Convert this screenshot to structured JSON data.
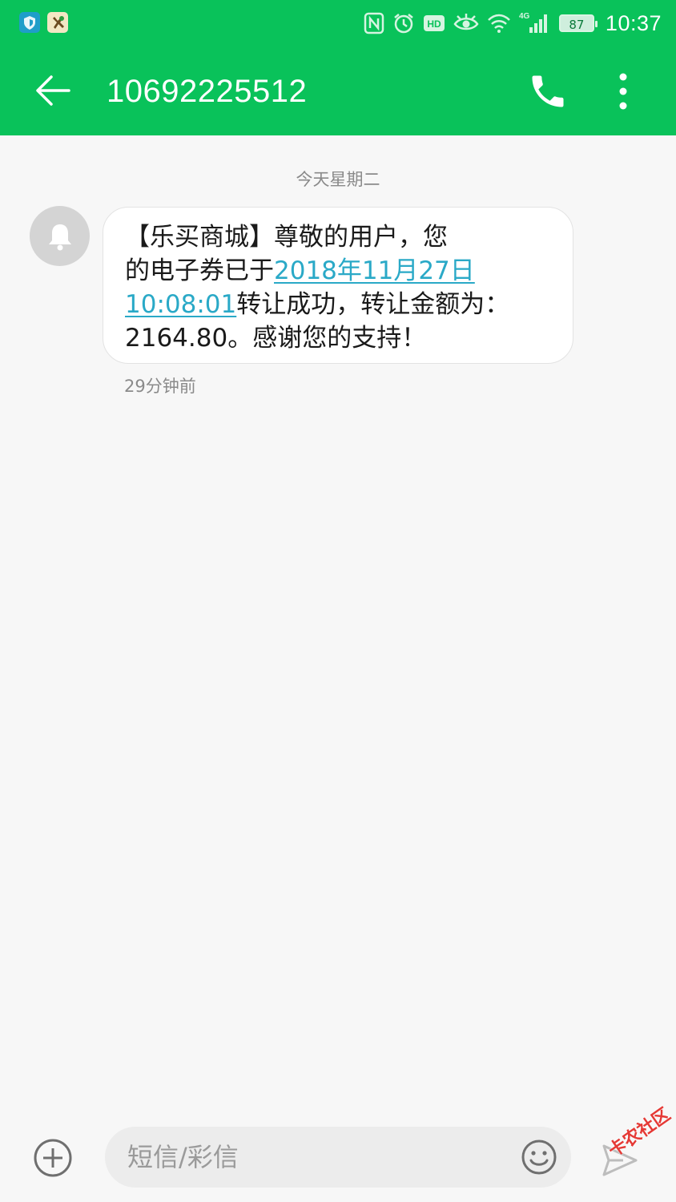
{
  "status_bar": {
    "time": "10:37",
    "battery": "87",
    "network": "4G",
    "icons": [
      "shield-app-icon",
      "tool-app-icon",
      "nfc-icon",
      "alarm-icon",
      "hd-icon",
      "eye-icon",
      "wifi-icon",
      "signal-icon",
      "battery-icon"
    ]
  },
  "toolbar": {
    "title": "10692225512",
    "back_icon": "back-arrow-icon",
    "call_icon": "phone-icon",
    "menu_icon": "more-vert-icon"
  },
  "conversation": {
    "date_header": "今天星期二",
    "message": {
      "line1": "【乐买商城】尊敬的用户，您",
      "line2_prefix": "的电子券已于",
      "line2_link": "2018年11月27日",
      "line3_link": "10:08:01",
      "line3_suffix": "转让成功，转让金额为：",
      "line4": "2164.80。感谢您的支持！"
    },
    "time": "29分钟前"
  },
  "input_bar": {
    "placeholder": "短信/彩信",
    "add_icon": "add-circle-icon",
    "emoji_icon": "emoji-icon",
    "send_icon": "send-icon"
  },
  "watermark": "卡农社区",
  "colors": {
    "accent": "#09c25a",
    "link": "#2aa9c7",
    "background": "#f7f7f7"
  }
}
